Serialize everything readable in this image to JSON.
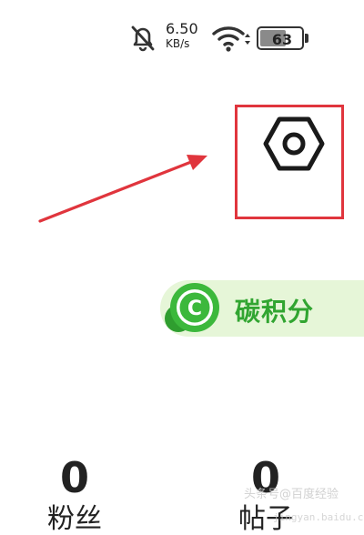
{
  "status_bar": {
    "icons": [
      "bell-off-icon",
      "wifi-icon",
      "battery-icon"
    ],
    "net_speed_value": "6.50",
    "net_speed_unit": "KB/s",
    "battery_level": "63",
    "battery_fraction": 0.63
  },
  "settings": {
    "icon": "hex-nut-settings-icon"
  },
  "annotation": {
    "color": "#e0353d"
  },
  "carbon_points": {
    "logo_letter": "C",
    "label": "碳积分",
    "accent_color": "#31a531",
    "background_color": "#e6f6d8"
  },
  "stats": {
    "fans": {
      "count": "0",
      "label": "粉丝"
    },
    "posts": {
      "count": "0",
      "label": "帖子"
    }
  },
  "watermark": {
    "text": "头条号@百度经验",
    "url": "jingyan.baidu.com"
  }
}
